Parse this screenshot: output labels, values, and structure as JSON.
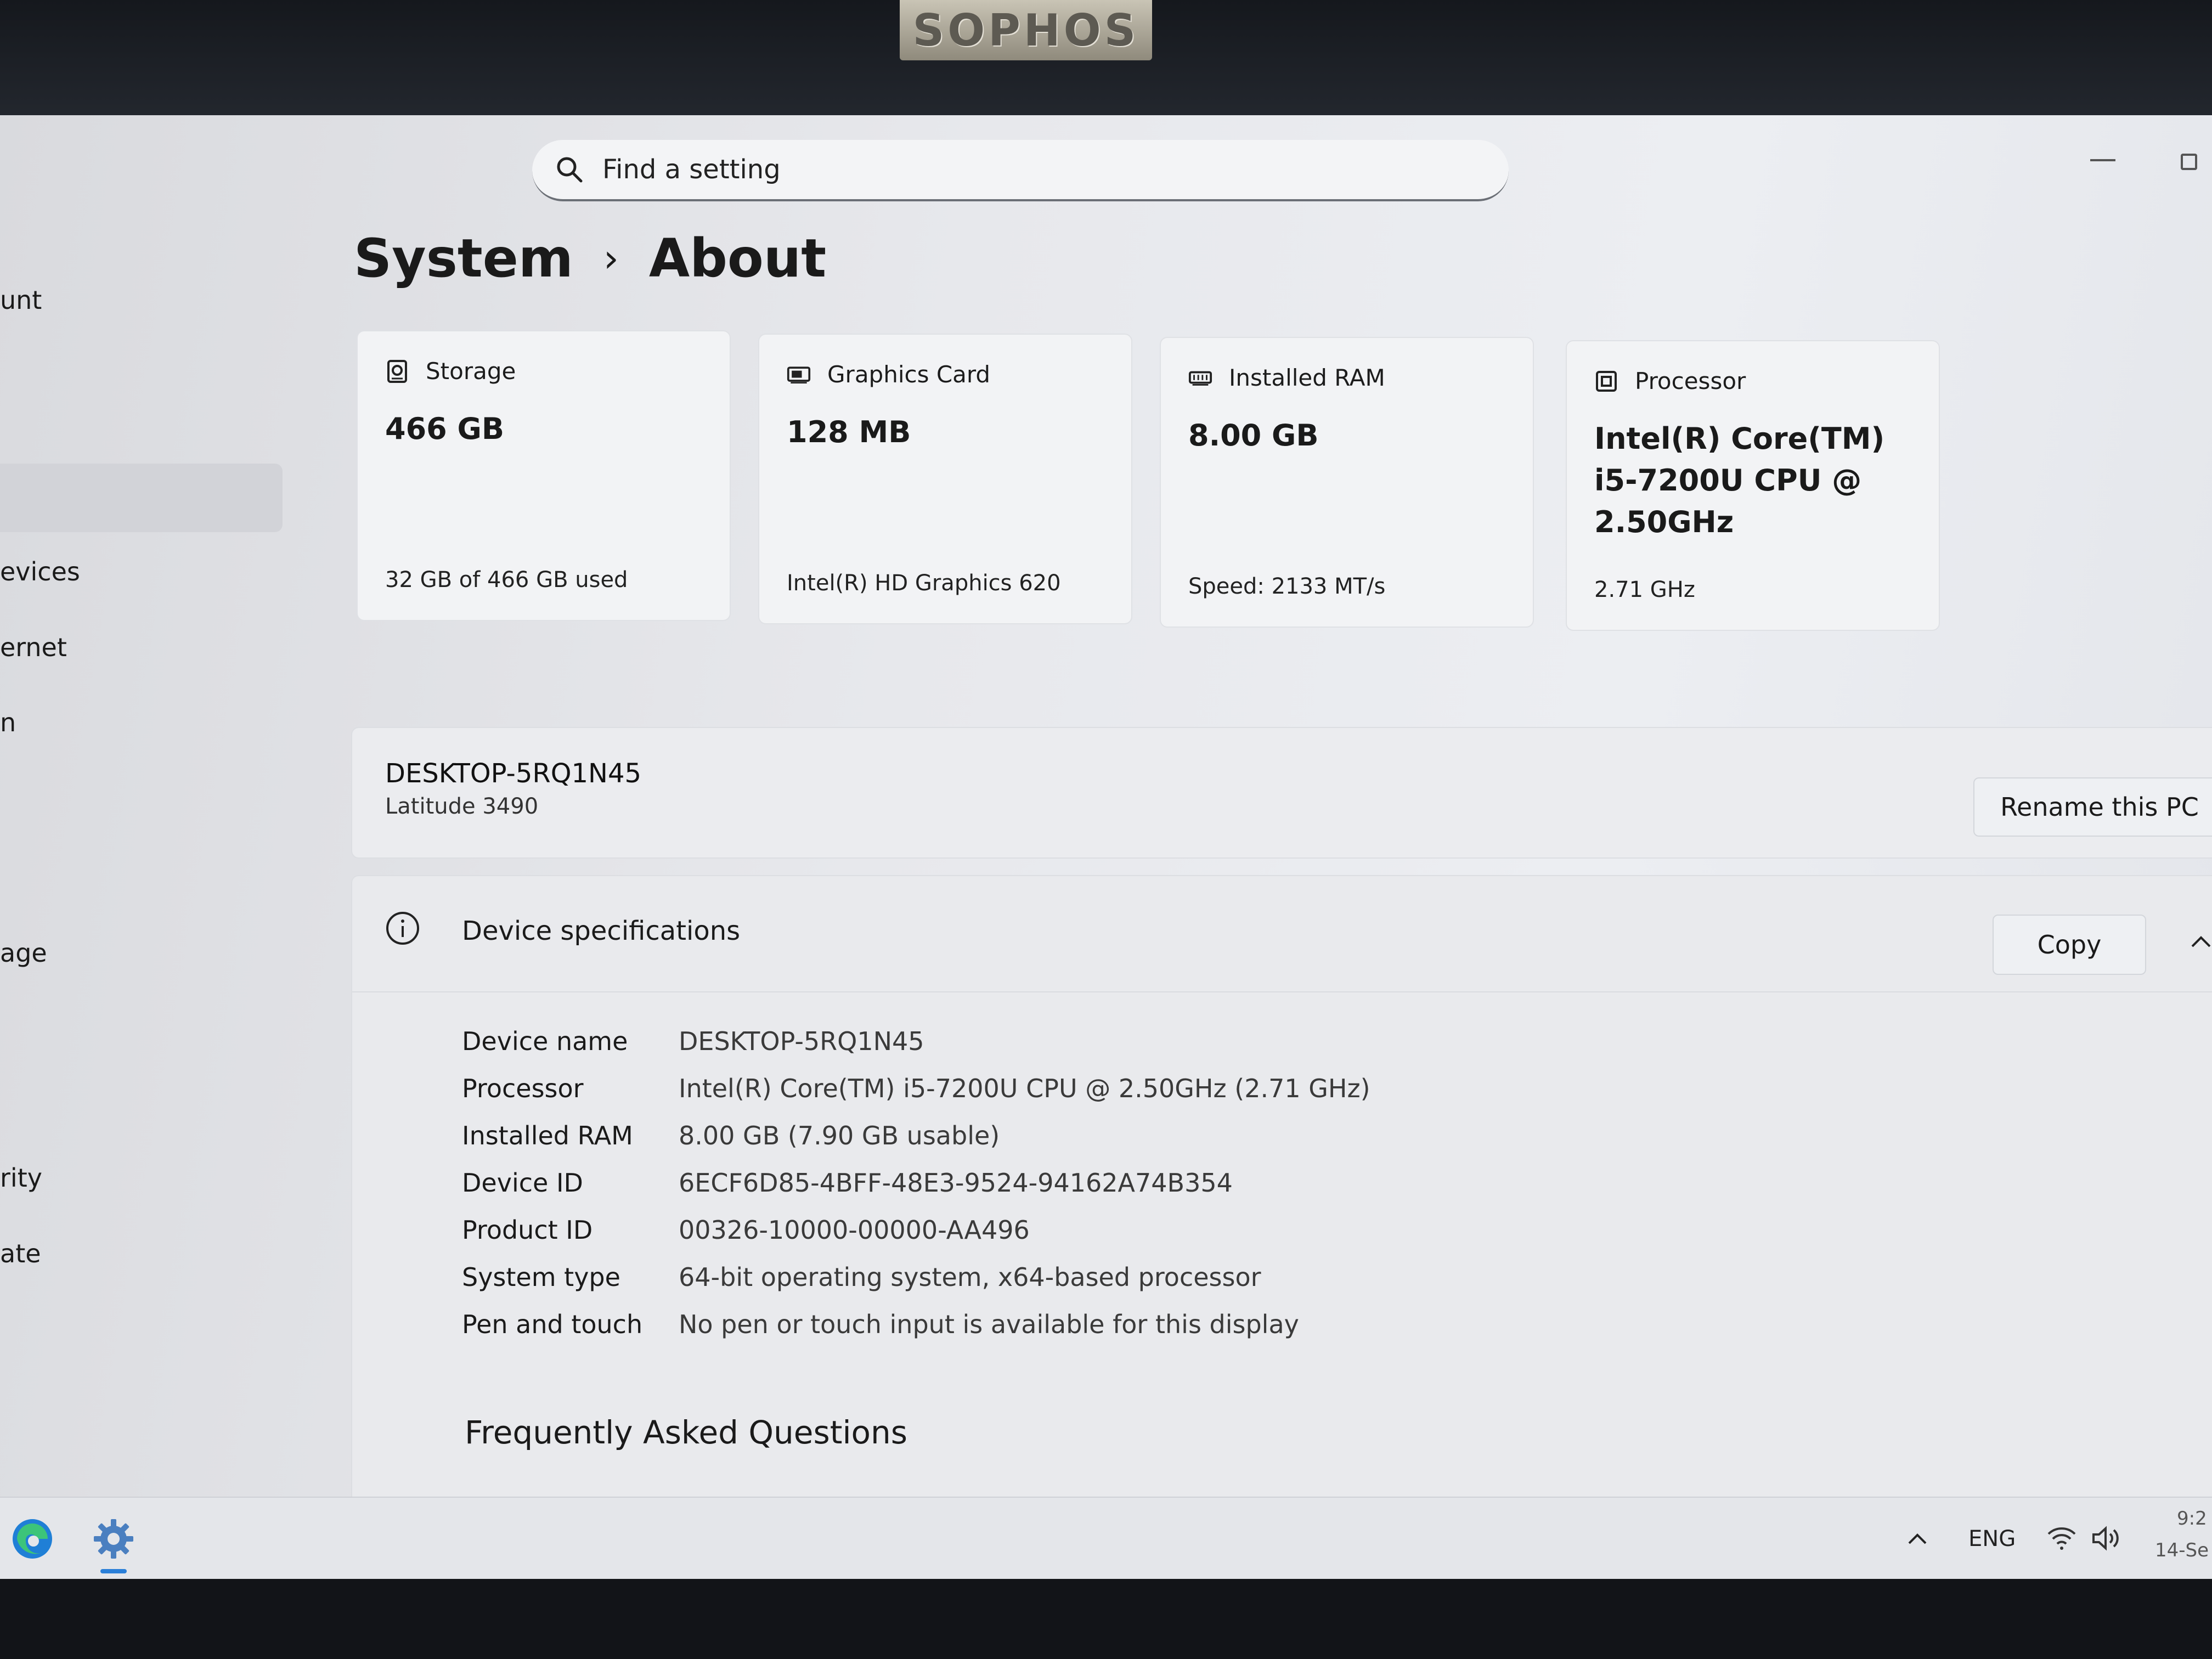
{
  "sticker": {
    "text": "SOPHOS"
  },
  "sidebar": {
    "items": [
      {
        "label": "unt"
      },
      {
        "label": "evices"
      },
      {
        "label": "ernet"
      },
      {
        "label": "n"
      },
      {
        "label": "age"
      },
      {
        "label": "rity"
      },
      {
        "label": "ate"
      }
    ]
  },
  "search": {
    "placeholder": "Find a setting",
    "icon": "search-icon"
  },
  "breadcrumb": {
    "parent": "System",
    "separator": "›",
    "current": "About"
  },
  "cards": [
    {
      "icon": "storage-icon",
      "title": "Storage",
      "value": "466 GB",
      "sub": "32 GB of 466 GB used"
    },
    {
      "icon": "graphics-card-icon",
      "title": "Graphics Card",
      "value": "128 MB",
      "sub": "Intel(R) HD Graphics 620"
    },
    {
      "icon": "ram-icon",
      "title": "Installed RAM",
      "value": "8.00 GB",
      "sub": "Speed: 2133 MT/s"
    },
    {
      "icon": "processor-icon",
      "title": "Processor",
      "value": "Intel(R) Core(TM) i5-7200U CPU @ 2.50GHz",
      "sub": "2.71 GHz"
    }
  ],
  "pc": {
    "name": "DESKTOP-5RQ1N45",
    "model": "Latitude 3490",
    "rename_label": "Rename this PC"
  },
  "specs": {
    "title": "Device specifications",
    "copy_label": "Copy",
    "rows": [
      {
        "label": "Device name",
        "value": "DESKTOP-5RQ1N45"
      },
      {
        "label": "Processor",
        "value": "Intel(R) Core(TM) i5-7200U CPU @ 2.50GHz (2.71 GHz)"
      },
      {
        "label": "Installed RAM",
        "value": "8.00 GB (7.90 GB usable)"
      },
      {
        "label": "Device ID",
        "value": "6ECF6D85-4BFF-48E3-9524-94162A74B354"
      },
      {
        "label": "Product ID",
        "value": "00326-10000-00000-AA496"
      },
      {
        "label": "System type",
        "value": "64-bit operating system, x64-based processor"
      },
      {
        "label": "Pen and touch",
        "value": "No pen or touch input is available for this display"
      }
    ]
  },
  "faq": {
    "title": "Frequently Asked Questions"
  },
  "taskbar": {
    "apps": [
      "edge-icon",
      "settings-gear-icon"
    ],
    "language": "ENG",
    "time": "9:2",
    "date": "14-Se"
  }
}
